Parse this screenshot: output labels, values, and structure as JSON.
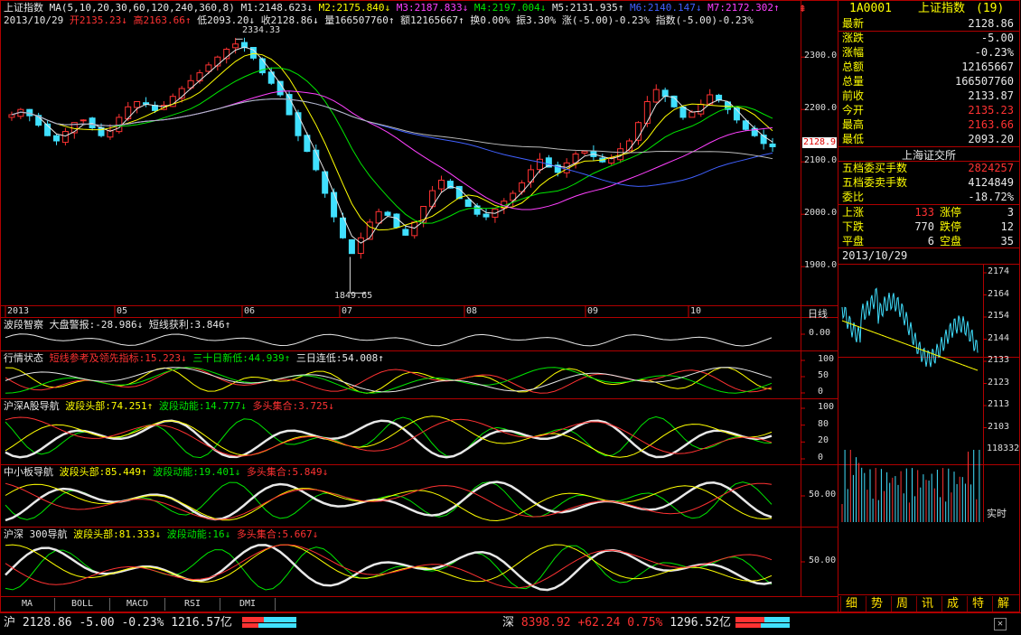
{
  "header": {
    "index_name": "上证指数",
    "ma_params": "MA(5,10,20,30,60,120,240,360,8)",
    "ma": [
      {
        "label": "M1:2148.623",
        "arrow": "↓",
        "color": "#e8e8e8"
      },
      {
        "label": "M2:2175.840",
        "arrow": "↓",
        "color": "#ffff00"
      },
      {
        "label": "M3:2187.833",
        "arrow": "↓",
        "color": "#ff40ff"
      },
      {
        "label": "M4:2197.004",
        "arrow": "↓",
        "color": "#00e600"
      },
      {
        "label": "M5:2131.935",
        "arrow": "↑",
        "color": "#e8e8e8"
      },
      {
        "label": "M6:2140.147",
        "arrow": "↓",
        "color": "#4060ff"
      },
      {
        "label": "M7:2172.302",
        "arrow": "↑",
        "color": "#ff40ff"
      }
    ],
    "date": "2013/10/29",
    "open": "开2135.23↓",
    "high": "高2163.66↑",
    "low": "低2093.20↓",
    "close": "收2128.86↓",
    "volume": "量166507760↑",
    "amount": "额12165667↑",
    "turnover": "换0.00%",
    "amplitude": "振3.30%",
    "change": "涨(-5.00)-0.23%",
    "index_change": "指数(-5.00)-0.23%"
  },
  "price_chart": {
    "y_ticks": [
      "2300.0",
      "2200.0",
      "2100.0",
      "2000.0",
      "1900.0"
    ],
    "current_price_tag": "2128.9",
    "high_label": "2334.33",
    "low_label": "1849.65",
    "x_months": [
      "2013",
      "05",
      "06",
      "07",
      "08",
      "09",
      "10"
    ],
    "x_axis_right": "日线"
  },
  "chart_data": {
    "type": "candlestick",
    "ylim": [
      1840,
      2340
    ],
    "y_ticks": [
      2300,
      2200,
      2100,
      2000,
      1900
    ],
    "closes": [
      2190,
      2200,
      2188,
      2170,
      2150,
      2140,
      2158,
      2175,
      2180,
      2165,
      2150,
      2160,
      2185,
      2205,
      2215,
      2210,
      2198,
      2208,
      2225,
      2240,
      2255,
      2270,
      2285,
      2300,
      2315,
      2325,
      2318,
      2298,
      2270,
      2250,
      2228,
      2190,
      2150,
      2120,
      2085,
      2040,
      1995,
      1955,
      1925,
      1955,
      1985,
      2005,
      1998,
      1975,
      1960,
      1985,
      2015,
      2045,
      2065,
      2050,
      2030,
      2015,
      2000,
      1995,
      2010,
      2025,
      2040,
      2060,
      2085,
      2105,
      2090,
      2080,
      2098,
      2115,
      2120,
      2110,
      2100,
      2108,
      2125,
      2140,
      2175,
      2215,
      2238,
      2225,
      2205,
      2185,
      2195,
      2210,
      2228,
      2218,
      2200,
      2180,
      2162,
      2150,
      2135,
      2128.86
    ],
    "last_close": 2128.86,
    "high_mark": 2334.33,
    "low_mark": 1849.65
  },
  "panels": [
    {
      "title": "波段智察",
      "items": [
        {
          "label": "大盘警报:-28.986↓",
          "color": "#e8e8e8"
        },
        {
          "label": "短线获利:3.846↑",
          "color": "#e8e8e8"
        }
      ],
      "ticks": [
        "0.00"
      ]
    },
    {
      "title": "行情状态",
      "items": [
        {
          "label": "短线参考及领先指标:15.223↓",
          "color": "#ff3232"
        },
        {
          "label": "三十日新低:44.939↑",
          "color": "#00e600"
        },
        {
          "label": "三日连低:54.008↑",
          "color": "#e8e8e8"
        }
      ],
      "ticks": [
        "100",
        "50",
        "0"
      ]
    },
    {
      "title": "沪深A股导航",
      "items": [
        {
          "label": "波段头部:74.251↑",
          "color": "#ffff00"
        },
        {
          "label": "波段动能:14.777↓",
          "color": "#00e600"
        },
        {
          "label": "多头集合:3.725↓",
          "color": "#ff3232"
        }
      ],
      "ticks": [
        "100",
        "80",
        "20",
        "0"
      ]
    },
    {
      "title": "中小板导航",
      "items": [
        {
          "label": "波段头部:85.449↑",
          "color": "#ffff00"
        },
        {
          "label": "波段动能:19.401↓",
          "color": "#00e600"
        },
        {
          "label": "多头集合:5.849↓",
          "color": "#ff3232"
        }
      ],
      "ticks": [
        "50.00"
      ]
    },
    {
      "title": "沪深 300导航",
      "items": [
        {
          "label": "波段头部:81.333↓",
          "color": "#ffff00"
        },
        {
          "label": "波段动能:16↓",
          "color": "#00e600"
        },
        {
          "label": "多头集合:5.667↓",
          "color": "#ff3232"
        }
      ],
      "ticks": [
        "50.00"
      ]
    }
  ],
  "tabs": [
    "MA",
    "BOLL",
    "MACD",
    "RSI",
    "DMI"
  ],
  "quote": {
    "code": "1A0001",
    "name": "上证指数",
    "count": "(19)",
    "rows": [
      {
        "label": "最新",
        "value": "2128.86",
        "color": "#e8e8e8"
      },
      {
        "label": "涨跌",
        "value": "-5.00",
        "color": "#e8e8e8"
      },
      {
        "label": "涨幅",
        "value": "-0.23%",
        "color": "#e8e8e8"
      },
      {
        "label": "总额",
        "value": "12165667",
        "color": "#e8e8e8"
      },
      {
        "label": "总量",
        "value": "166507760",
        "color": "#e8e8e8"
      },
      {
        "label": "前收",
        "value": "2133.87",
        "color": "#e8e8e8"
      },
      {
        "label": "今开",
        "value": "2135.23",
        "color": "#ff3232"
      },
      {
        "label": "最高",
        "value": "2163.66",
        "color": "#ff3232"
      },
      {
        "label": "最低",
        "value": "2093.20",
        "color": "#e8e8e8"
      }
    ],
    "exchange": "上海证交所",
    "rows2": [
      {
        "label": "五档委买手数",
        "value": "2824257",
        "color": "#ff3232"
      },
      {
        "label": "五档委卖手数",
        "value": "4124849",
        "color": "#e8e8e8"
      },
      {
        "label": "委比",
        "value": "-18.72%",
        "color": "#e8e8e8"
      }
    ],
    "updown": [
      {
        "l1": "上涨",
        "v1": "133",
        "c1": "#ff3232",
        "l2": "涨停",
        "v2": "3",
        "c2": "#e8e8e8"
      },
      {
        "l1": "下跌",
        "v1": "770",
        "c1": "#e8e8e8",
        "l2": "跌停",
        "v2": "12",
        "c2": "#e8e8e8"
      },
      {
        "l1": "平盘",
        "v1": "6",
        "c1": "#e8e8e8",
        "l2": "空盘",
        "v2": "35",
        "c2": "#e8e8e8"
      }
    ],
    "intraday_date": "2013/10/29",
    "intraday_ticks": [
      "2174",
      "2164",
      "2154",
      "2144",
      "2133",
      "2123",
      "2113",
      "2103"
    ],
    "volume_tick": "118332",
    "realtime_label": "实时"
  },
  "side_tabs": [
    "细",
    "势",
    "周",
    "讯",
    "成",
    "特",
    "解"
  ],
  "status": {
    "sh_label": "沪",
    "sh_price": "2128.86",
    "sh_change": "-5.00",
    "sh_pct": "-0.23%",
    "sh_amount": "1216.57亿",
    "sz_label": "深",
    "sz_price": "8398.92",
    "sz_change": "+62.24",
    "sz_pct": "0.75%",
    "sz_amount": "1296.52亿"
  }
}
